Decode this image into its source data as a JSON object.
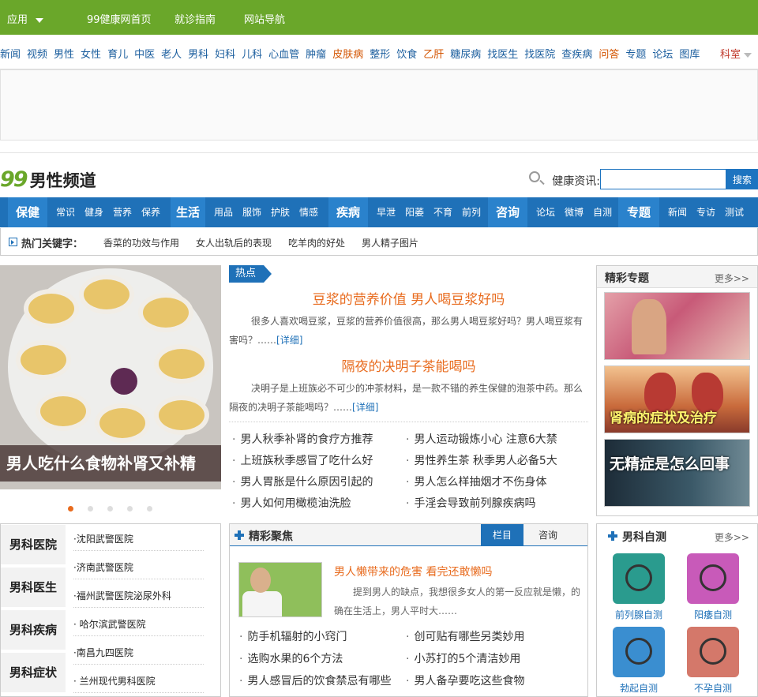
{
  "top_bar": {
    "apps_label": "应用",
    "links": [
      "99健康网首页",
      "就诊指南",
      "网站导航"
    ]
  },
  "channel_nav": {
    "items": [
      {
        "label": "新闻",
        "highlight": false
      },
      {
        "label": "视频",
        "highlight": false
      },
      {
        "label": "男性",
        "highlight": false
      },
      {
        "label": "女性",
        "highlight": false
      },
      {
        "label": "育儿",
        "highlight": false
      },
      {
        "label": "中医",
        "highlight": false
      },
      {
        "label": "老人",
        "highlight": false
      },
      {
        "label": "男科",
        "highlight": false
      },
      {
        "label": "妇科",
        "highlight": false
      },
      {
        "label": "儿科",
        "highlight": false
      },
      {
        "label": "心血管",
        "highlight": false
      },
      {
        "label": "肿瘤",
        "highlight": false
      },
      {
        "label": "皮肤病",
        "highlight": true
      },
      {
        "label": "整形",
        "highlight": false
      },
      {
        "label": "饮食",
        "highlight": false
      },
      {
        "label": "乙肝",
        "highlight": true
      },
      {
        "label": "糖尿病",
        "highlight": false
      },
      {
        "label": "找医生",
        "highlight": false
      },
      {
        "label": "找医院",
        "highlight": false
      },
      {
        "label": "查疾病",
        "highlight": false
      },
      {
        "label": "问答",
        "highlight": true
      },
      {
        "label": "专题",
        "highlight": false
      },
      {
        "label": "论坛",
        "highlight": false
      },
      {
        "label": "图库",
        "highlight": false
      }
    ],
    "keshi_label": "科室"
  },
  "logo": {
    "num": "99",
    "title": "男性频道"
  },
  "search": {
    "label": "健康资讯:",
    "value": "",
    "button": "搜索"
  },
  "blue_nav": [
    {
      "cat": "保健",
      "subs": [
        "常识",
        "健身",
        "营养",
        "保养"
      ]
    },
    {
      "cat": "生活",
      "subs": [
        "用品",
        "服饰",
        "护肤",
        "情感"
      ]
    },
    {
      "cat": "疾病",
      "subs": [
        "早泄",
        "阳萎",
        "不育",
        "前列"
      ]
    },
    {
      "cat": "咨询",
      "subs": [
        "论坛",
        "微博",
        "自测"
      ]
    },
    {
      "cat": "专题",
      "subs": [
        "新闻",
        "专访",
        "测试"
      ]
    }
  ],
  "hot_keywords": {
    "title": "热门关键字：",
    "items": [
      "香菜的功效与作用",
      "女人出轨后的表现",
      "吃羊肉的好处",
      "男人精子图片"
    ]
  },
  "slideshow": {
    "caption": "男人吃什么食物补肾又补精",
    "dots": 5,
    "active": 0
  },
  "hot": {
    "tag": "热点",
    "articles": [
      {
        "title": "豆浆的营养价值 男人喝豆浆好吗",
        "summary": "很多人喜欢喝豆浆，豆浆的营养价值很高，那么男人喝豆浆好吗？男人喝豆浆有害吗？……",
        "more": "[详细]"
      },
      {
        "title": "隔夜的决明子茶能喝吗",
        "summary": "决明子是上班族必不可少的冲茶材料，是一款不错的养生保健的泡茶中药。那么隔夜的决明子茶能喝吗？……",
        "more": "[详细]"
      }
    ],
    "list_left": [
      "男人秋季补肾的食疗方推荐",
      "上班族秋季感冒了吃什么好",
      "男人胃胀是什么原因引起的",
      "男人如何用橄榄油洗脸"
    ],
    "list_right": [
      "男人运动锻炼小心 注意6大禁",
      "男性养生茶 秋季男人必备5大",
      "男人怎么样抽烟才不伤身体",
      "手淫会导致前列腺疾病吗"
    ]
  },
  "topics": {
    "title": "精彩专题",
    "more": "更多>>",
    "items": [
      "",
      "肾病的症状及治疗",
      "无精症是怎么回事"
    ]
  },
  "left_box": {
    "tabs": [
      "男科医院",
      "男科医生",
      "男科疾病",
      "男科症状"
    ],
    "items": [
      "·沈阳武警医院",
      "·济南武警医院",
      "·福州武警医院泌尿外科",
      "· 哈尔滨武警医院",
      "·南昌九四医院",
      "· 兰州现代男科医院"
    ]
  },
  "focus": {
    "title": "精彩聚焦",
    "tabs": [
      "栏目",
      "咨询"
    ],
    "feature_title": "男人懒带来的危害 看完还敢懒吗",
    "feature_summary": "提到男人的缺点，我想很多女人的第一反应就是懒，的确在生活上，男人平时大……",
    "list_left": [
      "防手机辐射的小窍门",
      "选购水果的6个方法",
      "男人感冒后的饮食禁忌有哪些"
    ],
    "list_right": [
      "创可贴有哪些另类妙用",
      "小苏打的5个清洁妙用",
      "男人备孕要吃这些食物"
    ]
  },
  "self_test": {
    "title": "男科自测",
    "more": "更多>>",
    "items": [
      {
        "label": "前列腺自测",
        "color": "#2a9b8e"
      },
      {
        "label": "阳痿自测",
        "color": "#c85ab9"
      },
      {
        "label": "勃起自测",
        "color": "#3a8ed0"
      },
      {
        "label": "不孕自测",
        "color": "#d4786a"
      }
    ]
  }
}
